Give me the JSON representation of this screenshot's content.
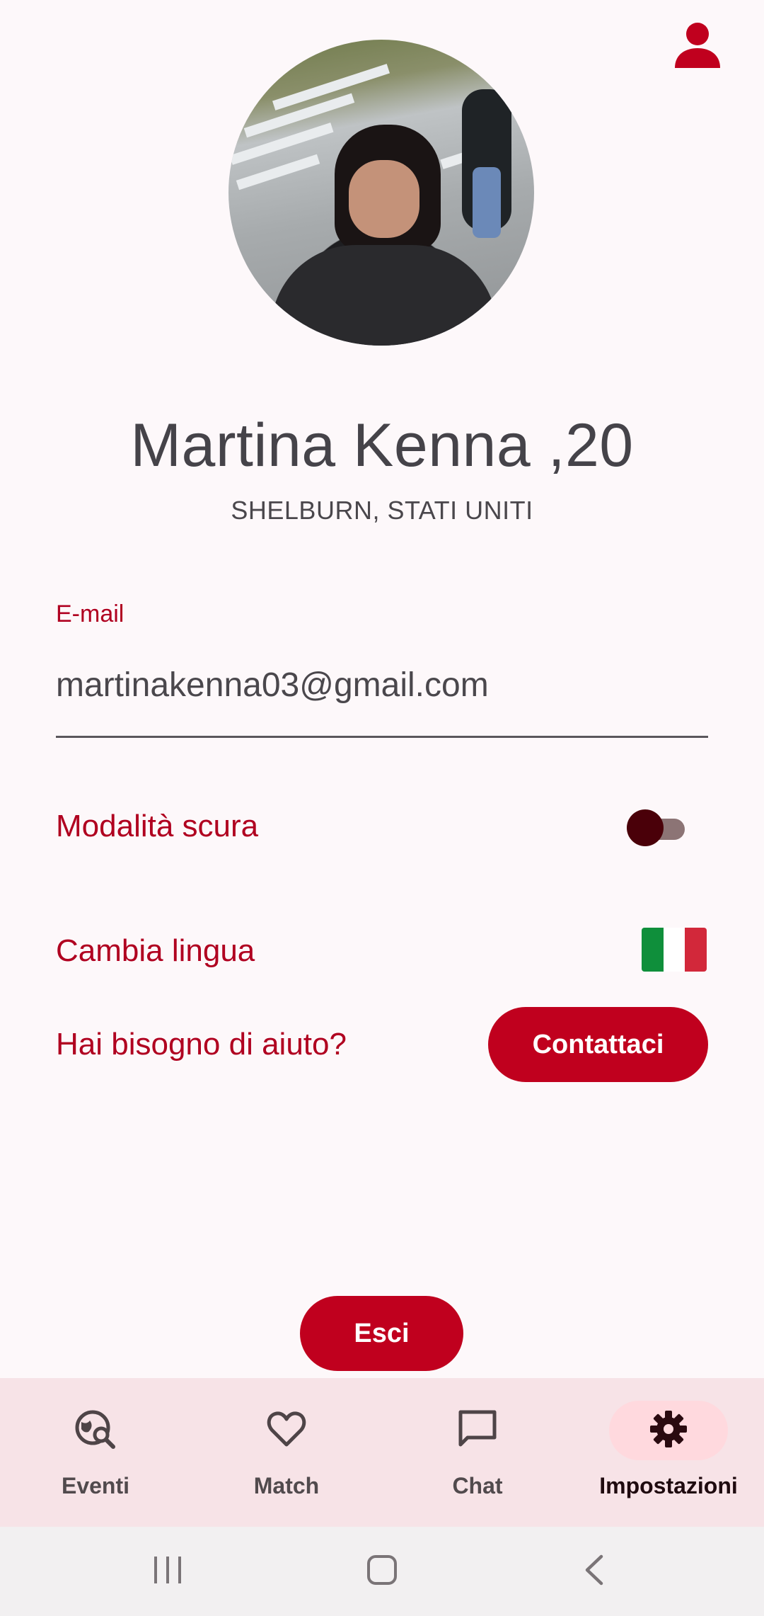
{
  "profile": {
    "name": "Martina Kenna ,20",
    "location": "SHELBURN, STATI UNITI"
  },
  "email": {
    "label": "E-mail",
    "value": "martinakenna03@gmail.com"
  },
  "settings": {
    "dark_mode_label": "Modalità scura",
    "dark_mode_on": false,
    "language_label": "Cambia lingua",
    "language_flag": "italy-flag",
    "help_label": "Hai bisogno di aiuto?",
    "contact_button": "Contattaci"
  },
  "logout_button": "Esci",
  "bottom_nav": {
    "items": [
      {
        "label": "Eventi",
        "icon": "event-search-icon"
      },
      {
        "label": "Match",
        "icon": "heart-icon"
      },
      {
        "label": "Chat",
        "icon": "chat-icon"
      },
      {
        "label": "Impostazioni",
        "icon": "gear-icon",
        "active": true
      }
    ]
  },
  "colors": {
    "accent": "#c0001e",
    "text_accent": "#b00020",
    "background": "#fdf8fa",
    "nav_background": "#f7e3e7"
  }
}
